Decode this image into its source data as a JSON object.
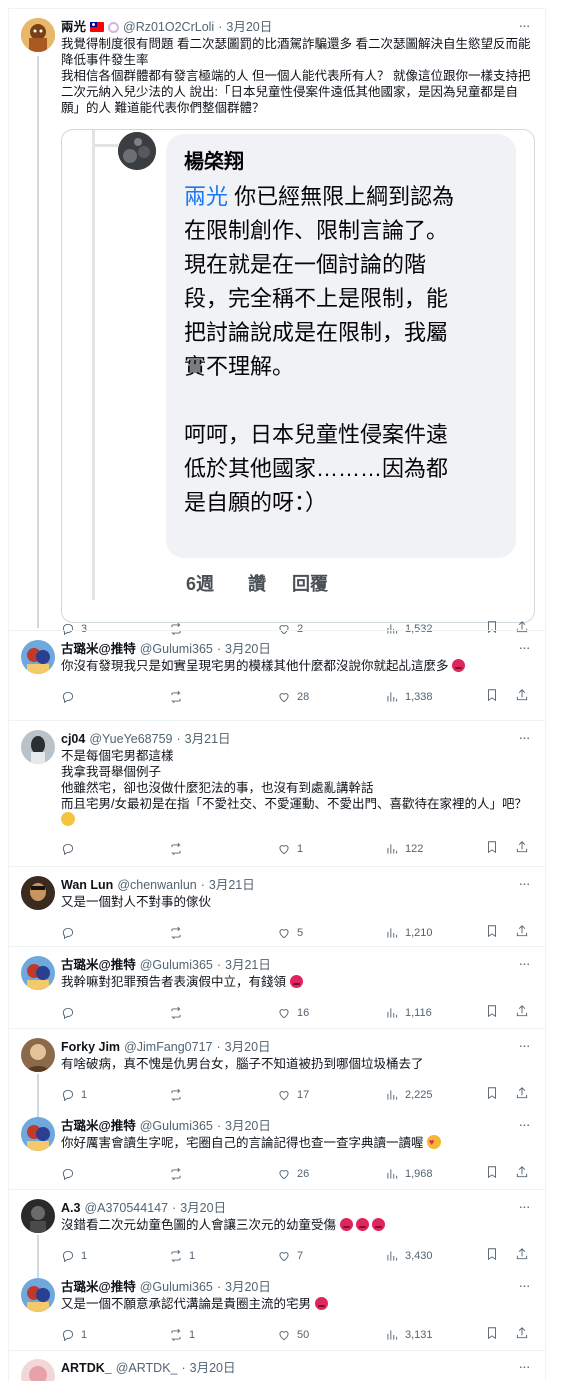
{
  "posts": [
    {
      "name": "兩光",
      "handle": "@Rz01O2CrLoli",
      "date": "3月20日",
      "lines": [
        "我覺得制度很有問題 看二次瑟圖罰的比酒駕詐騙還多 看二次瑟圖解決自生慾望反而能",
        "降低事件發生率",
        "我相信各個群體都有發言極端的人 但一個人能代表所有人？ 就像這位跟你一樣支持把",
        "二次元納入兒少法的人 說出:「日本兒童性侵案件遠低其他國家，是因為兒童都是自",
        "願」的人 難道能代表你們整個群體？"
      ],
      "stats": {
        "replies": "3",
        "reposts": "",
        "likes": "2",
        "views": "1,532"
      },
      "quote": {
        "author": "楊棨翔",
        "mention": "兩光",
        "line1": " 你已經無限上綱到認為",
        "lines": [
          "在限制創作、限制言論了。",
          "現在就是在一個討論的階",
          "段，完全稱不上是限制，能",
          "把討論說成是在限制，我屬",
          "實不理解。",
          "",
          "呵呵，日本兒童性侵案件遠",
          "低於其他國家………因為都",
          "是自願的呀：）"
        ],
        "time": "6週",
        "like_label": "讚",
        "reply_label": "回覆"
      }
    },
    {
      "name": "古璐米@推特",
      "handle": "@Gulumi365",
      "date": "3月20日",
      "lines": [
        "你沒有發現我只是如實呈現宅男的模樣其他什麼都沒說你就起乩這麼多"
      ],
      "stats": {
        "replies": "",
        "reposts": "",
        "likes": "28",
        "views": "1,338"
      }
    },
    {
      "name": "cj04",
      "handle": "@YueYe68759",
      "date": "3月21日",
      "lines": [
        "不是每個宅男都這樣",
        "我拿我哥舉個例子",
        "他雖然宅，卻也沒做什麼犯法的事，也沒有到處亂講幹話",
        "而且宅男/女最初是在指「不愛社交、不愛運動、不愛出門、喜歡待在家裡的人」吧？"
      ],
      "stats": {
        "replies": "",
        "reposts": "",
        "likes": "1",
        "views": "122"
      }
    },
    {
      "name": "Wan Lun",
      "handle": "@chenwanlun",
      "date": "3月21日",
      "lines": [
        "又是一個對人不對事的傢伙"
      ],
      "stats": {
        "replies": "",
        "reposts": "",
        "likes": "5",
        "views": "1,210"
      }
    },
    {
      "name": "古璐米@推特",
      "handle": "@Gulumi365",
      "date": "3月21日",
      "lines": [
        "我幹嘛對犯罪預告者表演假中立，有錢領"
      ],
      "stats": {
        "replies": "",
        "reposts": "",
        "likes": "16",
        "views": "1,116"
      }
    },
    {
      "name": "Forky Jim",
      "handle": "@JimFang0717",
      "date": "3月20日",
      "lines": [
        "有啥破病，真不愧是仇男台女，腦子不知道被扔到哪個垃圾桶去了"
      ],
      "stats": {
        "replies": "1",
        "reposts": "",
        "likes": "17",
        "views": "2,225"
      }
    },
    {
      "name": "古璐米@推特",
      "handle": "@Gulumi365",
      "date": "3月20日",
      "lines": [
        "你好厲害會讀生字呢，宅圈自己的言論記得也查一查字典讀一讀喔"
      ],
      "stats": {
        "replies": "",
        "reposts": "",
        "likes": "26",
        "views": "1,968"
      }
    },
    {
      "name": "A.3",
      "handle": "@A370544147",
      "date": "3月20日",
      "lines": [
        "沒錯看二次元幼童色圖的人會讓三次元的幼童受傷"
      ],
      "stats": {
        "replies": "1",
        "reposts": "1",
        "likes": "7",
        "views": "3,430"
      }
    },
    {
      "name": "古璐米@推特",
      "handle": "@Gulumi365",
      "date": "3月20日",
      "lines": [
        "又是一個不願意承認代溝論是貴圈主流的宅男"
      ],
      "stats": {
        "replies": "1",
        "reposts": "1",
        "likes": "50",
        "views": "3,131"
      }
    },
    {
      "name": "ARTDK_",
      "handle": "@ARTDK_",
      "date": "3月20日",
      "lines": [],
      "stats": {}
    }
  ],
  "colors": {
    "text": "#0f1419",
    "secondary": "#536471",
    "border": "#eff3f4",
    "mention": "#1877f2"
  }
}
